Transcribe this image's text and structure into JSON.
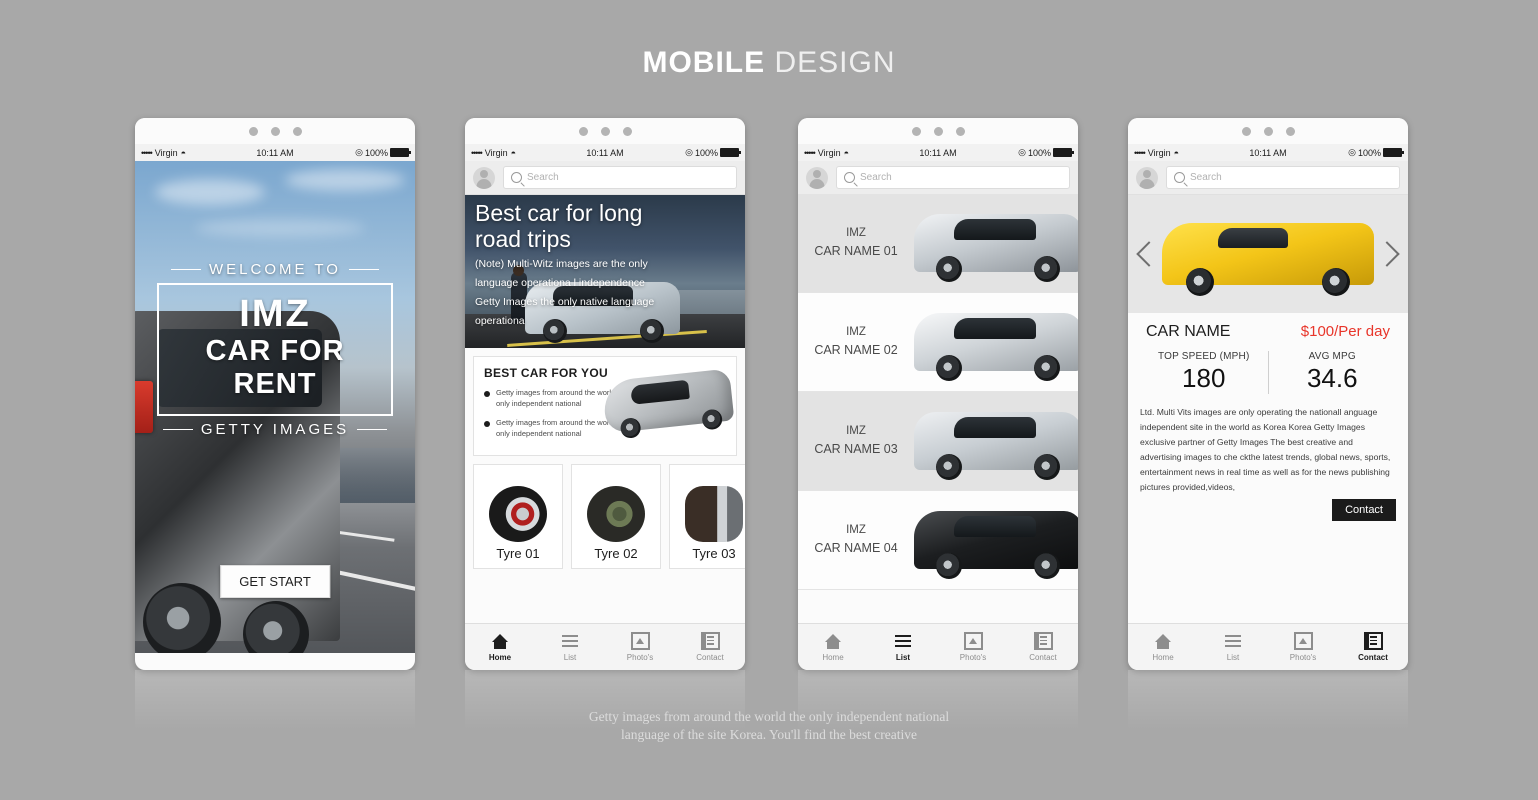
{
  "page": {
    "title_bold": "MOBILE",
    "title_thin": " DESIGN",
    "caption_line1": "Getty images from around the world the only independent national",
    "caption_line2": "language of the site Korea. You'll find the best creative",
    "background_color": "#a8a8a8",
    "accent_red": "#e8352a"
  },
  "status_bar": {
    "signal_dots": "•••••",
    "carrier": "Virgin",
    "wifi_icon": "wifi-icon",
    "time": "10:11 AM",
    "location_icon": "location-icon",
    "battery_percent": "100%",
    "battery_icon": "battery-icon"
  },
  "search": {
    "placeholder": "Search",
    "icon": "search-icon",
    "avatar": "avatar-icon"
  },
  "nav": {
    "items": [
      {
        "label": "Home",
        "icon": "home-icon"
      },
      {
        "label": "List",
        "icon": "list-icon"
      },
      {
        "label": "Photo's",
        "icon": "photo-icon"
      },
      {
        "label": "Contact",
        "icon": "contact-document-icon"
      }
    ],
    "active_screen1": "Home",
    "active_screen2": "Home",
    "active_screen3": "List",
    "active_screen4": "Contact"
  },
  "screen1": {
    "welcome_label": "WELCOME TO",
    "brand": "IMZ",
    "headline": "CAR FOR RENT",
    "sublabel": "GETTY IMAGES",
    "cta": "GET START"
  },
  "screen2": {
    "hero_title_line1": "Best car for long",
    "hero_title_line2": "road trips",
    "hero_note_line1": "(Note) Multi-Witz images are the only",
    "hero_note_line2": "language operationa l independence",
    "hero_note_line3": "Getty Images the only native language",
    "hero_note_line4": "operationa",
    "card_title": "BEST CAR FOR YOU",
    "bullets": [
      "Getty images from around the world the only  independent national",
      "Getty images from around the world the only  independent national"
    ],
    "tyres": [
      {
        "label": "Tyre 01"
      },
      {
        "label": "Tyre 02"
      },
      {
        "label": "Tyre 03"
      }
    ]
  },
  "screen3": {
    "rows": [
      {
        "brand": "IMZ",
        "name": "CAR NAME 01"
      },
      {
        "brand": "IMZ",
        "name": "CAR NAME 02"
      },
      {
        "brand": "IMZ",
        "name": "CAR NAME 03"
      },
      {
        "brand": "IMZ",
        "name": "CAR NAME 04"
      }
    ]
  },
  "screen4": {
    "prev_arrow": "chevron-left-icon",
    "next_arrow": "chevron-right-icon",
    "car_name": "CAR NAME",
    "price": "$100/Per day",
    "spec1_label": "TOP SPEED (MPH)",
    "spec1_value": "180",
    "spec2_label": "AVG MPG",
    "spec2_value": "34.6",
    "description": "Ltd. Multi Vits images are only operating the nationall anguage independent site in the world as Korea Korea Getty Images exclusive partner of Getty Images The best creative and advertising images to che ckthe latest trends, global news, sports, entertainment news in real time as well as for the news publishing  pictures provided,videos,",
    "contact_button": "Contact"
  }
}
